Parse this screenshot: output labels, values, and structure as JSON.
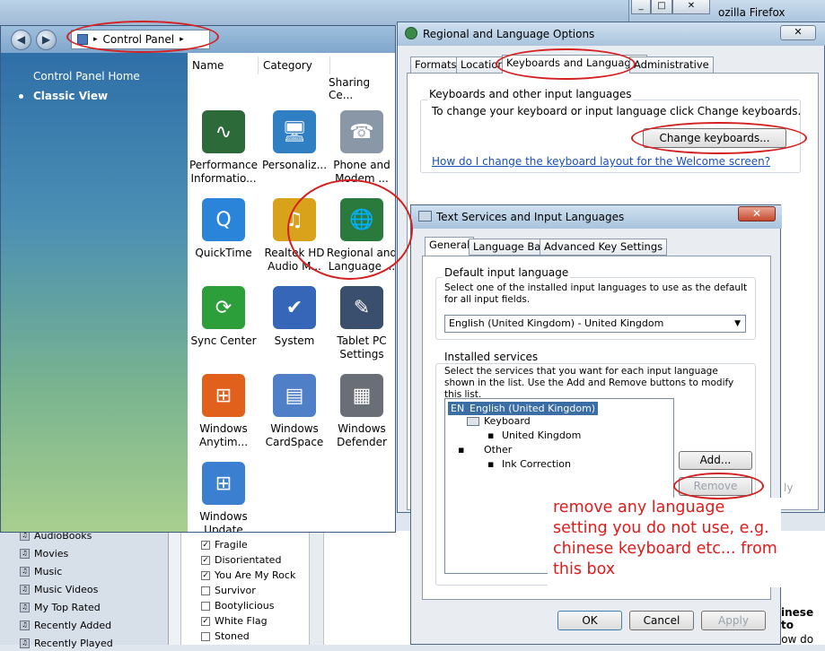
{
  "background": {
    "firefox_title": "ozilla Firefox",
    "window_buttons": [
      "_",
      "□",
      "✕"
    ],
    "playlists": [
      "AudioBooks",
      "Movies",
      "Music",
      "Music Videos",
      "My Top Rated",
      "Recently Added",
      "Recently Played"
    ],
    "songs": [
      {
        "title": "Fragile",
        "checked": true
      },
      {
        "title": "Disorientated",
        "checked": true
      },
      {
        "title": "You Are My Rock",
        "checked": true
      },
      {
        "title": "Survivor",
        "checked": false
      },
      {
        "title": "Bootylicious",
        "checked": false
      },
      {
        "title": "White Flag",
        "checked": true
      },
      {
        "title": "Stoned",
        "checked": false
      }
    ],
    "side_text": "inese to",
    "side_text2": "Thanks Tom, but how do"
  },
  "control_panel": {
    "address_label": "Control Panel",
    "side_links": [
      "Control Panel Home",
      "Classic View"
    ],
    "columns": [
      "Name",
      "Category"
    ],
    "partial_label": "Sharing Ce...",
    "items": [
      {
        "label": "Performance Informatio...",
        "icon": "performance-icon",
        "color": "#2d6a3a",
        "glyph": "∿"
      },
      {
        "label": "Personaliz...",
        "icon": "personalization-icon",
        "color": "#2f7fc2",
        "glyph": "🖥"
      },
      {
        "label": "Phone and Modem ...",
        "icon": "phone-icon",
        "color": "#8a97a6",
        "glyph": "☎"
      },
      {
        "label": "QuickTime",
        "icon": "quicktime-icon",
        "color": "#2a84d9",
        "glyph": "Q"
      },
      {
        "label": "Realtek HD Audio M...",
        "icon": "audio-icon",
        "color": "#d8a21a",
        "glyph": "♫"
      },
      {
        "label": "Regional and Language ...",
        "icon": "globe-clock-icon",
        "color": "#2a7a3e",
        "glyph": "🌐"
      },
      {
        "label": "Sync Center",
        "icon": "sync-icon",
        "color": "#2c9e3a",
        "glyph": "⟳"
      },
      {
        "label": "System",
        "icon": "system-icon",
        "color": "#3566b8",
        "glyph": "✔"
      },
      {
        "label": "Tablet PC Settings",
        "icon": "tablet-icon",
        "color": "#3a4e6e",
        "glyph": "✎"
      },
      {
        "label": "Windows Anytim...",
        "icon": "windows-icon",
        "color": "#e0601c",
        "glyph": "⊞"
      },
      {
        "label": "Windows CardSpace",
        "icon": "cardspace-icon",
        "color": "#4f7fc6",
        "glyph": "▤"
      },
      {
        "label": "Windows Defender",
        "icon": "defender-icon",
        "color": "#6a6f77",
        "glyph": "▦"
      },
      {
        "label": "Windows Update",
        "icon": "update-icon",
        "color": "#3b7fd0",
        "glyph": "⊞"
      }
    ]
  },
  "regional": {
    "title": "Regional and Language Options",
    "tabs": [
      "Formats",
      "Location",
      "Keyboards and Languages",
      "Administrative"
    ],
    "group_label": "Keyboards and other input languages",
    "group_text": "To change your keyboard or input language click Change keyboards.",
    "change_button": "Change keyboards...",
    "help_link": "How do I change the keyboard layout for the Welcome screen?",
    "apply_partial": "ly"
  },
  "text_services": {
    "title": "Text Services and Input Languages",
    "tabs": [
      "General",
      "Language Bar",
      "Advanced Key Settings"
    ],
    "default_group_label": "Default input language",
    "default_text": "Select one of the installed input languages to use as the default for all input fields.",
    "default_value": "English (United Kingdom) - United Kingdom",
    "installed_label": "Installed services",
    "installed_text": "Select the services that you want for each input language shown in the list. Use the Add and Remove buttons to modify this list.",
    "tree": {
      "lang_code": "EN",
      "lang_name": "English (United Kingdom)",
      "keyboard": "Keyboard",
      "keyboard_layout": "United Kingdom",
      "other": "Other",
      "other_item": "Ink Correction"
    },
    "add_button": "Add...",
    "remove_button": "Remove",
    "ok_button": "OK",
    "cancel_button": "Cancel",
    "apply_button": "Apply"
  },
  "annotation": {
    "note": "remove any language setting you do not use, e.g. chinese keyboard etc... from this box",
    "color": "#e01b1b"
  }
}
